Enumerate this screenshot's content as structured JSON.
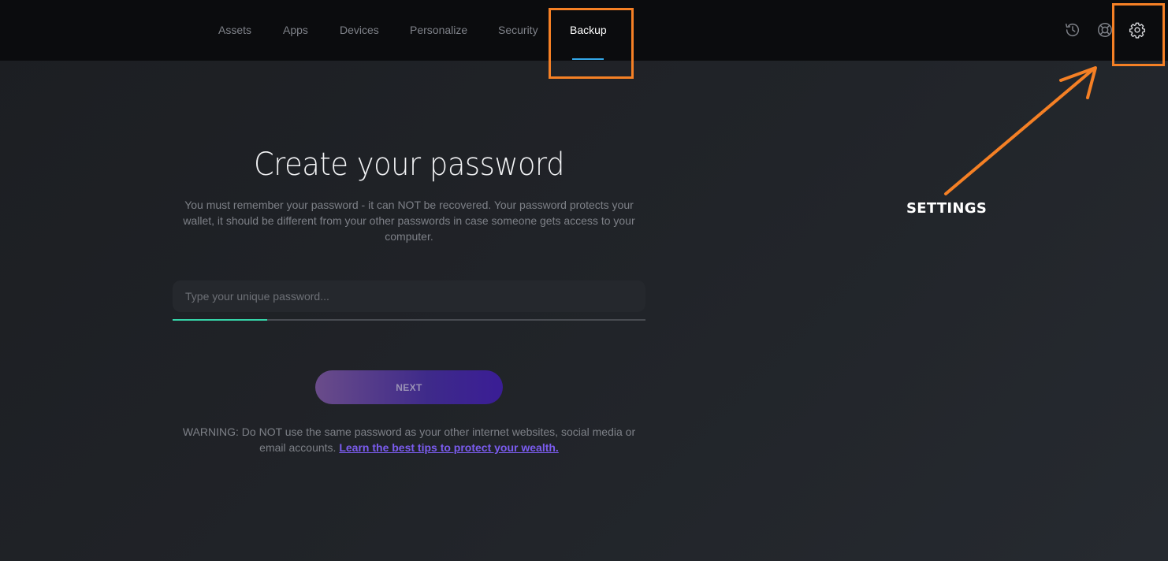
{
  "nav": {
    "tabs": [
      {
        "label": "Assets",
        "active": false
      },
      {
        "label": "Apps",
        "active": false
      },
      {
        "label": "Devices",
        "active": false
      },
      {
        "label": "Personalize",
        "active": false
      },
      {
        "label": "Security",
        "active": false
      },
      {
        "label": "Backup",
        "active": true
      }
    ],
    "icons": [
      "history-icon",
      "help-lifebuoy-icon",
      "gear-icon"
    ],
    "accent_color": "#34a8e8"
  },
  "main": {
    "title": "Create your password",
    "description": "You must remember your password - it can NOT be recovered. Your password protects your wallet, it should be different from your other passwords in case someone gets access to your computer.",
    "password_input": {
      "value": "",
      "placeholder": "Type your unique password..."
    },
    "strength": {
      "fraction": 0.2,
      "color": "#36d3a8"
    },
    "next_label": "NEXT",
    "warning_text": "WARNING: Do NOT use the same password as your other internet websites, social media or email accounts.",
    "warning_link": "Learn the best tips to protect your wealth."
  },
  "annotation": {
    "label": "SETTINGS",
    "color": "#f58025"
  }
}
